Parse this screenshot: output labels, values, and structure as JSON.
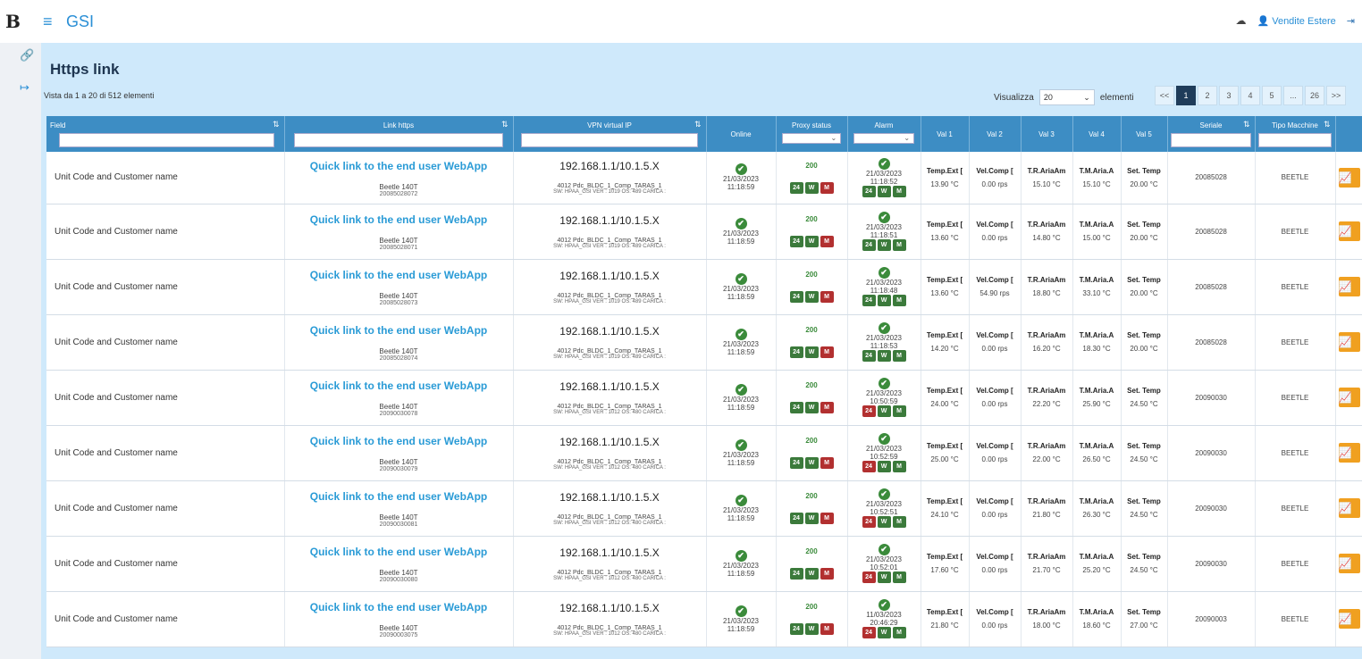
{
  "app": {
    "logo": "B",
    "menu_icon": "≡",
    "title": "GSI"
  },
  "topbar": {
    "cloud_icon": "☁",
    "user_icon": "👤",
    "user_label": "Vendite Estere",
    "logout_icon": "⇥"
  },
  "rail": {
    "link_icon": "🔗",
    "exit_icon": "↦"
  },
  "page": {
    "title": "Https link",
    "info": "Vista da 1 a 20 di 512 elementi",
    "show_label": "Visualizza",
    "show_value": "20",
    "show_suffix": "elementi",
    "pager": [
      "<<",
      "1",
      "2",
      "3",
      "4",
      "5",
      "...",
      "26",
      ">>"
    ]
  },
  "columns": {
    "field": "Field",
    "link": "Link https",
    "vpn": "VPN virtual IP",
    "online": "Online",
    "proxy": "Proxy status",
    "alarm": "Alarm",
    "val1": "Val 1",
    "val2": "Val 2",
    "val3": "Val 3",
    "val4": "Val 4",
    "val5": "Val 5",
    "serial": "Seriale",
    "machine": "Tipo Macchine"
  },
  "rows": [
    {
      "field": "Unit Code and Customer name",
      "link": "Quick link to the end user WebApp",
      "model": "Beetle 140T",
      "code": "20085028072",
      "ip": "192.168.1.1/10.1.5.X",
      "vpn_sub": "4012 Pdc_BLDC_1_Comp_TARAS_1",
      "vpn_sw": "SW: HPAA_GSI VER : 1019 OS: 489 CARICA :",
      "online_date": "21/03/2023",
      "online_time": "11:18:59",
      "proxy": "200",
      "alarm_date": "21/03/2023",
      "alarm_time": "11:18:52",
      "b24": "24",
      "bw": "W",
      "bm": "M",
      "h1": "Temp.Ext [",
      "h2": "Vel.Comp [",
      "h3": "T.R.AriaAm",
      "h4": "T.M.Aria.A",
      "h5": "Set. Temp",
      "v1": "13.90 °C",
      "v2": "0.00 rps",
      "v3": "15.10 °C",
      "v4": "15.10 °C",
      "v5": "20.00 °C",
      "serial": "20085028",
      "machine": "BEETLE"
    },
    {
      "field": "Unit Code and Customer name",
      "link": "Quick link to the end user WebApp",
      "model": "Beetle 140T",
      "code": "20085028071",
      "ip": "192.168.1.1/10.1.5.X",
      "vpn_sub": "4012 Pdc_BLDC_1_Comp_TARAS_1",
      "vpn_sw": "SW: HPAA_GSI VER : 1019 OS: 489 CARICA :",
      "online_date": "21/03/2023",
      "online_time": "11:18:59",
      "proxy": "200",
      "alarm_date": "21/03/2023",
      "alarm_time": "11:18:51",
      "b24": "24",
      "bw": "W",
      "bm": "M",
      "h1": "Temp.Ext [",
      "h2": "Vel.Comp [",
      "h3": "T.R.AriaAm",
      "h4": "T.M.Aria.A",
      "h5": "Set. Temp",
      "v1": "13.60 °C",
      "v2": "0.00 rps",
      "v3": "14.80 °C",
      "v4": "15.00 °C",
      "v5": "20.00 °C",
      "serial": "20085028",
      "machine": "BEETLE"
    },
    {
      "field": "Unit Code and Customer name",
      "link": "Quick link to the end user WebApp",
      "model": "Beetle 140T",
      "code": "20085028073",
      "ip": "192.168.1.1/10.1.5.X",
      "vpn_sub": "4012 Pdc_BLDC_1_Comp_TARAS_1",
      "vpn_sw": "SW: HPAA_GSI VER : 1019 OS: 489 CARICA :",
      "online_date": "21/03/2023",
      "online_time": "11:18:59",
      "proxy": "200",
      "alarm_date": "21/03/2023",
      "alarm_time": "11:18:48",
      "b24": "24",
      "bw": "W",
      "bm": "M",
      "h1": "Temp.Ext [",
      "h2": "Vel.Comp [",
      "h3": "T.R.AriaAm",
      "h4": "T.M.Aria.A",
      "h5": "Set. Temp",
      "v1": "13.60 °C",
      "v2": "54.90 rps",
      "v3": "18.80 °C",
      "v4": "33.10 °C",
      "v5": "20.00 °C",
      "serial": "20085028",
      "machine": "BEETLE"
    },
    {
      "field": "Unit Code and Customer name",
      "link": "Quick link to the end user WebApp",
      "model": "Beetle 140T",
      "code": "20085028074",
      "ip": "192.168.1.1/10.1.5.X",
      "vpn_sub": "4012 Pdc_BLDC_1_Comp_TARAS_1",
      "vpn_sw": "SW: HPAA_GSI VER : 1019 OS: 489 CARICA :",
      "online_date": "21/03/2023",
      "online_time": "11:18:59",
      "proxy": "200",
      "alarm_date": "21/03/2023",
      "alarm_time": "11:18:53",
      "b24": "24",
      "bw": "W",
      "bm": "M",
      "h1": "Temp.Ext [",
      "h2": "Vel.Comp [",
      "h3": "T.R.AriaAm",
      "h4": "T.M.Aria.A",
      "h5": "Set. Temp",
      "v1": "14.20 °C",
      "v2": "0.00 rps",
      "v3": "16.20 °C",
      "v4": "18.30 °C",
      "v5": "20.00 °C",
      "serial": "20085028",
      "machine": "BEETLE"
    },
    {
      "field": "Unit Code and Customer name",
      "link": "Quick link to the end user WebApp",
      "model": "Beetle 140T",
      "code": "20090030078",
      "ip": "192.168.1.1/10.1.5.X",
      "vpn_sub": "4012 Pdc_BLDC_1_Comp_TARAS_1",
      "vpn_sw": "SW: HPAA_GSI VER : 1012 OS: 480 CARICA :",
      "online_date": "21/03/2023",
      "online_time": "11:18:59",
      "proxy": "200",
      "alarm_date": "21/03/2023",
      "alarm_time": "10:50:59",
      "b24": "24",
      "bw": "W",
      "bm": "M",
      "h1": "Temp.Ext [",
      "h2": "Vel.Comp [",
      "h3": "T.R.AriaAm",
      "h4": "T.M.Aria.A",
      "h5": "Set. Temp",
      "v1": "24.00 °C",
      "v2": "0.00 rps",
      "v3": "22.20 °C",
      "v4": "25.90 °C",
      "v5": "24.50 °C",
      "serial": "20090030",
      "machine": "BEETLE"
    },
    {
      "field": "Unit Code and Customer name",
      "link": "Quick link to the end user WebApp",
      "model": "Beetle 140T",
      "code": "20090030079",
      "ip": "192.168.1.1/10.1.5.X",
      "vpn_sub": "4012 Pdc_BLDC_1_Comp_TARAS_1",
      "vpn_sw": "SW: HPAA_GSI VER : 1012 OS: 480 CARICA :",
      "online_date": "21/03/2023",
      "online_time": "11:18:59",
      "proxy": "200",
      "alarm_date": "21/03/2023",
      "alarm_time": "10:52:59",
      "b24": "24",
      "bw": "W",
      "bm": "M",
      "h1": "Temp.Ext [",
      "h2": "Vel.Comp [",
      "h3": "T.R.AriaAm",
      "h4": "T.M.Aria.A",
      "h5": "Set. Temp",
      "v1": "25.00 °C",
      "v2": "0.00 rps",
      "v3": "22.00 °C",
      "v4": "26.50 °C",
      "v5": "24.50 °C",
      "serial": "20090030",
      "machine": "BEETLE"
    },
    {
      "field": "Unit Code and Customer name",
      "link": "Quick link to the end user WebApp",
      "model": "Beetle 140T",
      "code": "20090030081",
      "ip": "192.168.1.1/10.1.5.X",
      "vpn_sub": "4012 Pdc_BLDC_1_Comp_TARAS_1",
      "vpn_sw": "SW: HPAA_GSI VER : 1012 OS: 480 CARICA :",
      "online_date": "21/03/2023",
      "online_time": "11:18:59",
      "proxy": "200",
      "alarm_date": "21/03/2023",
      "alarm_time": "10:52:51",
      "b24": "24",
      "bw": "W",
      "bm": "M",
      "h1": "Temp.Ext [",
      "h2": "Vel.Comp [",
      "h3": "T.R.AriaAm",
      "h4": "T.M.Aria.A",
      "h5": "Set. Temp",
      "v1": "24.10 °C",
      "v2": "0.00 rps",
      "v3": "21.80 °C",
      "v4": "26.30 °C",
      "v5": "24.50 °C",
      "serial": "20090030",
      "machine": "BEETLE"
    },
    {
      "field": "Unit Code and Customer name",
      "link": "Quick link to the end user WebApp",
      "model": "Beetle 140T",
      "code": "20090030080",
      "ip": "192.168.1.1/10.1.5.X",
      "vpn_sub": "4012 Pdc_BLDC_1_Comp_TARAS_1",
      "vpn_sw": "SW: HPAA_GSI VER : 1012 OS: 480 CARICA :",
      "online_date": "21/03/2023",
      "online_time": "11:18:59",
      "proxy": "200",
      "alarm_date": "21/03/2023",
      "alarm_time": "10:52:01",
      "b24": "24",
      "bw": "W",
      "bm": "M",
      "h1": "Temp.Ext [",
      "h2": "Vel.Comp [",
      "h3": "T.R.AriaAm",
      "h4": "T.M.Aria.A",
      "h5": "Set. Temp",
      "v1": "17.60 °C",
      "v2": "0.00 rps",
      "v3": "21.70 °C",
      "v4": "25.20 °C",
      "v5": "24.50 °C",
      "serial": "20090030",
      "machine": "BEETLE"
    },
    {
      "field": "Unit Code and Customer name",
      "link": "Quick link to the end user WebApp",
      "model": "Beetle 140T",
      "code": "20090003075",
      "ip": "192.168.1.1/10.1.5.X",
      "vpn_sub": "4012 Pdc_BLDC_1_Comp_TARAS_1",
      "vpn_sw": "SW: HPAA_GSI VER : 1012 OS: 480 CARICA :",
      "online_date": "21/03/2023",
      "online_time": "11:18:59",
      "proxy": "200",
      "alarm_date": "11/03/2023",
      "alarm_time": "20:46:29",
      "b24": "24",
      "bw": "W",
      "bm": "M",
      "h1": "Temp.Ext [",
      "h2": "Vel.Comp [",
      "h3": "T.R.AriaAm",
      "h4": "T.M.Aria.A",
      "h5": "Set. Temp",
      "v1": "21.80 °C",
      "v2": "0.00 rps",
      "v3": "18.00 °C",
      "v4": "18.60 °C",
      "v5": "27.00 °C",
      "serial": "20090003",
      "machine": "BEETLE"
    }
  ],
  "alarm_first_badge_red": [
    false,
    false,
    false,
    false,
    true,
    true,
    true,
    true,
    true
  ],
  "proxy_check_icon": "✔",
  "sort_icon": "⇅",
  "chevron": "⌄",
  "action_icon": "📈"
}
